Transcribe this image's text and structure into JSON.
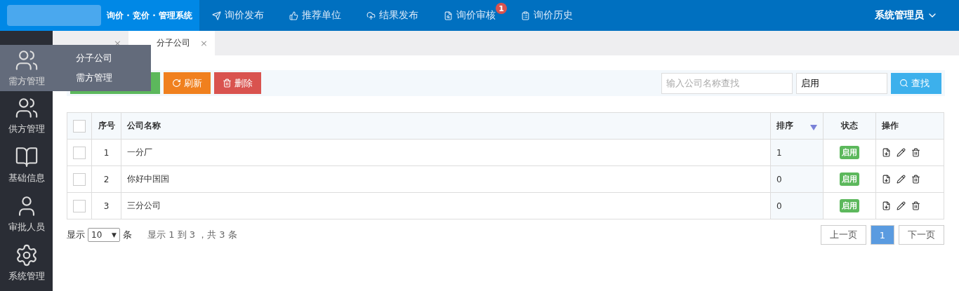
{
  "header": {
    "system_name": "询价 · 竞价 · 管理系统",
    "nav": [
      {
        "label": "询价发布"
      },
      {
        "label": "推荐单位"
      },
      {
        "label": "结果发布"
      },
      {
        "label": "询价审核",
        "badge": "1"
      },
      {
        "label": "询价历史"
      }
    ],
    "user": "系统管理员"
  },
  "sidebar": {
    "items": [
      {
        "label": "需方管理",
        "selected": true,
        "submenu": [
          "分子公司",
          "需方管理"
        ]
      },
      {
        "label": "供方管理",
        "selected": false
      },
      {
        "label": "基础信息",
        "selected": false
      },
      {
        "label": "审批人员",
        "selected": false
      },
      {
        "label": "系统管理",
        "selected": false
      }
    ]
  },
  "tabs": [
    {
      "close": "×",
      "selected": false
    },
    {
      "label": "分子公司",
      "close": "×",
      "selected": true
    }
  ],
  "toolbar": {
    "buttons": [
      {
        "kind": "add"
      },
      {
        "kind": "refresh",
        "label": "刷新"
      },
      {
        "kind": "delete",
        "label": "删除"
      }
    ],
    "search": {
      "placeholder": "输入公司名称查找"
    },
    "status_filter": "启用",
    "search_button": "查找"
  },
  "table": {
    "all_checked": false,
    "columns": [
      {
        "label": "序号",
        "sorted": false
      },
      {
        "label": "公司名称",
        "sorted": false
      },
      {
        "label": "排序",
        "sorted": true
      },
      {
        "label": "状态",
        "sorted": false
      },
      {
        "label": "操作",
        "sorted": false
      }
    ],
    "rows": [
      {
        "checked": false,
        "cells": [
          "1",
          "一分厂",
          "1"
        ],
        "status": "启用"
      },
      {
        "checked": false,
        "cells": [
          "2",
          "你好中国国",
          "0"
        ],
        "status": "启用"
      },
      {
        "checked": false,
        "cells": [
          "3",
          "三分公司",
          "0"
        ],
        "status": "启用"
      }
    ]
  },
  "footer": {
    "show_label": "显示",
    "page_size": "10",
    "caret": "▼",
    "unit": "条",
    "summary": "显示 1 到 3 ，共 3 条"
  },
  "pagination": {
    "prev": "上一页",
    "pages": [
      {
        "label": "1",
        "selected": true
      }
    ],
    "next": "下一页"
  }
}
